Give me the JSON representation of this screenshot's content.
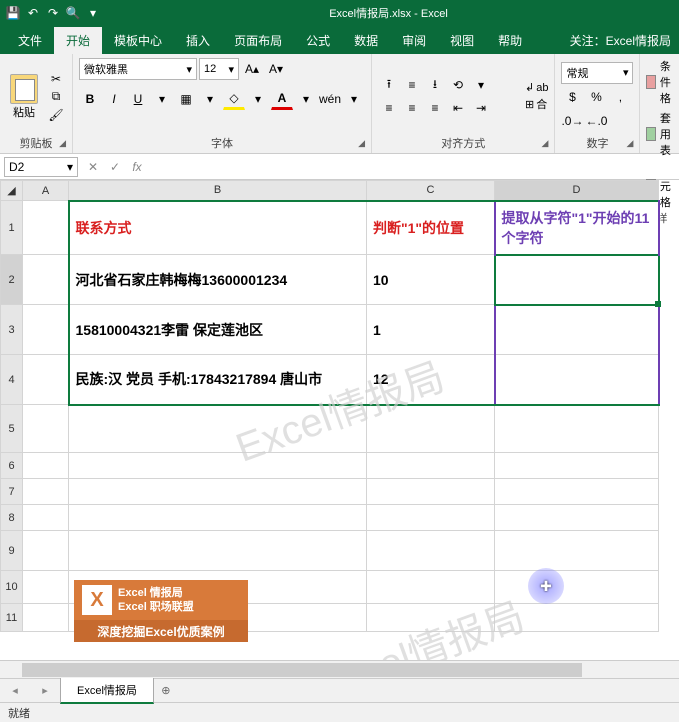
{
  "titlebar": {
    "title": "Excel情报局.xlsx - Excel"
  },
  "tabs": {
    "file": "文件",
    "home": "开始",
    "template": "模板中心",
    "insert": "插入",
    "layout": "页面布局",
    "formula": "公式",
    "data": "数据",
    "review": "审阅",
    "view": "视图",
    "help": "帮助",
    "about": "关注：Excel情报局"
  },
  "ribbon": {
    "clipboard": {
      "paste": "粘贴",
      "label": "剪贴板"
    },
    "font": {
      "name": "微软雅黑",
      "size": "12",
      "label": "字体"
    },
    "align": {
      "wrap": "ab",
      "merge": "合",
      "label": "对齐方式"
    },
    "number": {
      "format": "常规",
      "label": "数字"
    },
    "styles": {
      "cond": "条件格",
      "table": "套用表",
      "cell": "单元格",
      "label": "样"
    }
  },
  "formula_bar": {
    "name_box": "D2",
    "fx": "fx",
    "value": ""
  },
  "columns": [
    "A",
    "B",
    "C",
    "D"
  ],
  "rows": [
    "1",
    "2",
    "3",
    "4",
    "5",
    "6",
    "7",
    "8",
    "9",
    "10",
    "11"
  ],
  "table": {
    "headers": {
      "b": "联系方式",
      "c": "判断\"1\"的位置",
      "d": "提取从字符\"1\"开始的11个字符"
    },
    "rows": [
      {
        "b": "河北省石家庄韩梅梅13600001234",
        "c": "10",
        "d": ""
      },
      {
        "b": "15810004321李雷 保定莲池区",
        "c": "1",
        "d": ""
      },
      {
        "b": "民族:汉 党员 手机:17843217894 唐山市",
        "c": "12",
        "d": ""
      }
    ]
  },
  "logo": {
    "line1": "Excel 情报局",
    "line2": "Excel 职场联盟",
    "bottom": "深度挖掘Excel优质案例"
  },
  "sheet_tab": "Excel情报局",
  "status": "就绪",
  "watermark": "Excel情报局"
}
